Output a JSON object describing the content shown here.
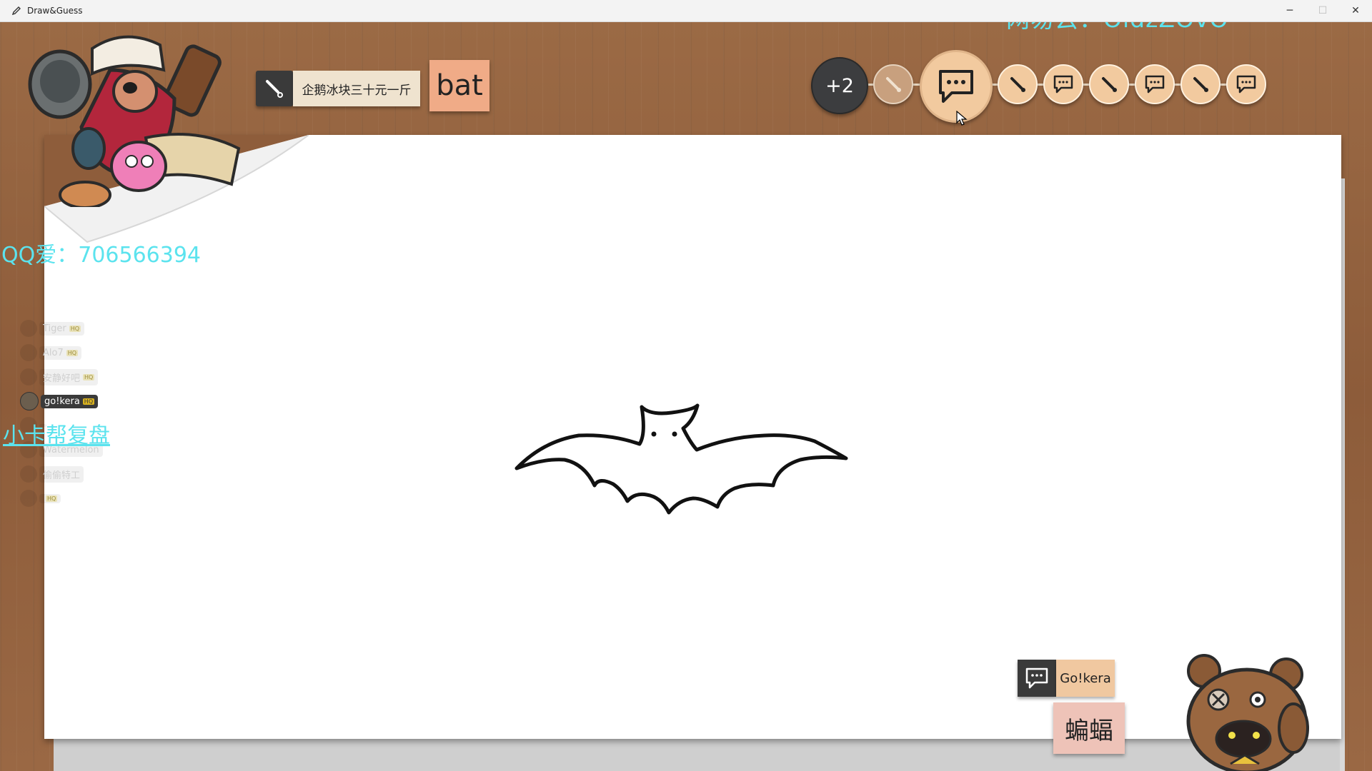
{
  "window": {
    "title": "Draw&Guess",
    "minimize": "─",
    "maximize": "☐",
    "close": "✕"
  },
  "watermarks": {
    "top": "网易云：OldzZOvO",
    "qq": "QQ爱：706566394",
    "card": "小卡帮复盘"
  },
  "prompt": {
    "tool_label": "企鹅冰块三十元一斤",
    "word": "bat"
  },
  "timeline": {
    "more_label": "+2"
  },
  "players": [
    {
      "name": "Tiger",
      "badge": "HQ",
      "active": false
    },
    {
      "name": "Alo7",
      "badge": "HQ",
      "active": false
    },
    {
      "name": "安静好吧",
      "badge": "HQ",
      "active": false
    },
    {
      "name": "go!kera",
      "badge": "HQ",
      "active": true
    },
    {
      "name": "",
      "badge": "",
      "active": false
    },
    {
      "name": "Watermelon",
      "badge": "",
      "active": false
    },
    {
      "name": "偷偷特工",
      "badge": "",
      "active": false
    },
    {
      "name": "",
      "badge": "HQ",
      "active": false
    }
  ],
  "guess": {
    "player": "Go!kera",
    "word": "蝙蝠"
  },
  "colors": {
    "watermark": "#5be3ee",
    "dark_box": "#3a3a3a",
    "word_card": "#f0ab87",
    "timeline_node": "#f2ca9f"
  }
}
